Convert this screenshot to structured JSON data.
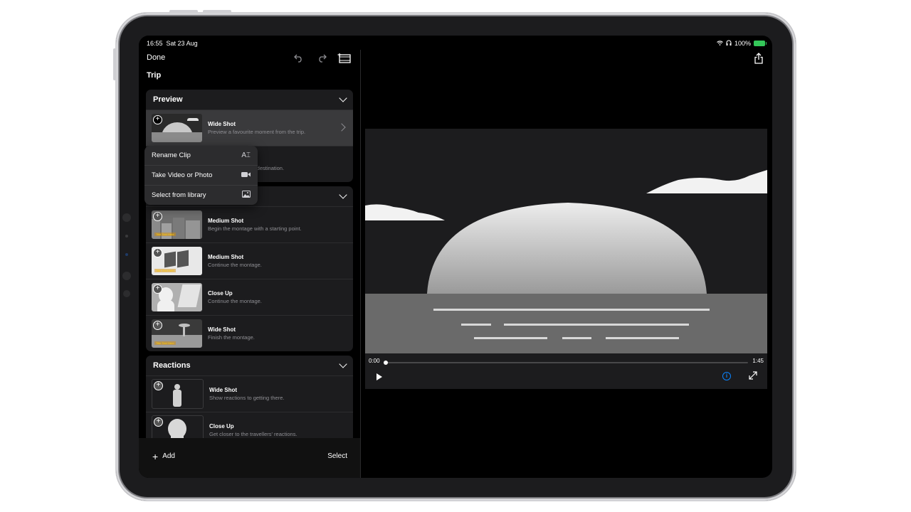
{
  "status_bar": {
    "time": "16:55",
    "date": "Sat 23 Aug",
    "battery": "100%",
    "wifi_icon": "wifi-icon",
    "headphones_icon": "headphones-icon"
  },
  "toolbar": {
    "done_label": "Done",
    "project_title": "Trip"
  },
  "sections": {
    "preview": {
      "title": "Preview",
      "shots": [
        {
          "name": "Wide Shot",
          "desc": "Preview a favourite moment from the trip."
        },
        {
          "name": "",
          "desc": "des the destination."
        }
      ]
    },
    "montage": {
      "shots": [
        {
          "name": "Medium Shot",
          "desc": "Begin the montage with a starting point."
        },
        {
          "name": "Medium Shot",
          "desc": "Continue the montage."
        },
        {
          "name": "Close Up",
          "desc": "Continue the montage."
        },
        {
          "name": "Wide Shot",
          "desc": "Finish the montage."
        }
      ]
    },
    "reactions": {
      "title": "Reactions",
      "shots": [
        {
          "name": "Wide Shot",
          "desc": "Show reactions to getting there."
        },
        {
          "name": "Close Up",
          "desc": "Get closer to the travellers' reactions."
        }
      ]
    }
  },
  "context_menu": {
    "items": [
      {
        "label": "Rename Clip",
        "icon": "rename-icon"
      },
      {
        "label": "Take Video or Photo",
        "icon": "camera-icon"
      },
      {
        "label": "Select from library",
        "icon": "photo-icon"
      }
    ]
  },
  "bottom_bar": {
    "add_label": "Add",
    "select_label": "Select"
  },
  "player": {
    "current_time": "0:00",
    "duration": "1:45",
    "progress": 0
  },
  "colors": {
    "accent": "#0a84ff",
    "background": "#000000",
    "panel": "#1c1c1e",
    "battery": "#34c759"
  }
}
